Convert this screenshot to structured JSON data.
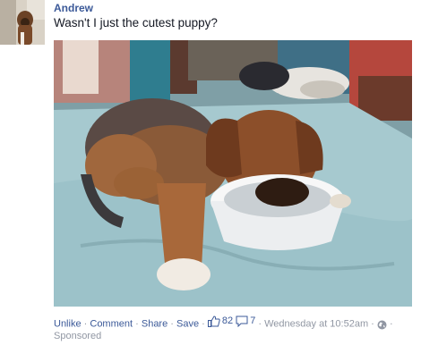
{
  "post": {
    "author": "Andrew",
    "message": "Wasn't I just the cutest puppy?",
    "photo_icon": "puppy-photo"
  },
  "footer": {
    "unlike": "Unlike",
    "comment": "Comment",
    "share": "Share",
    "save": "Save",
    "likes_count": "82",
    "comments_count": "7",
    "timestamp": "Wednesday at 10:52am",
    "sponsored": "Sponsored",
    "separator": "·"
  },
  "colors": {
    "link": "#3b5998",
    "muted": "#9197a3"
  }
}
